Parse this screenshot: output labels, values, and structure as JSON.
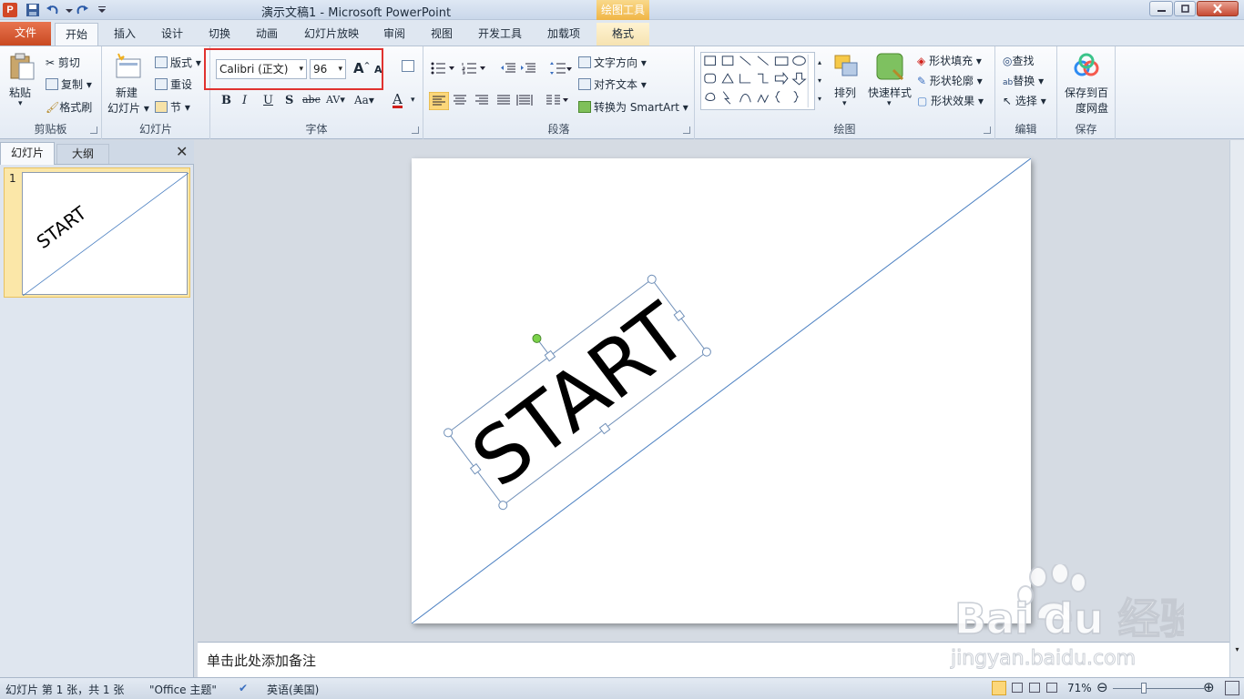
{
  "window": {
    "title": "演示文稿1 - Microsoft PowerPoint",
    "contextual_header": "绘图工具"
  },
  "app_icon_letter": "P",
  "tabs": [
    {
      "label": "文件"
    },
    {
      "label": "开始"
    },
    {
      "label": "插入"
    },
    {
      "label": "设计"
    },
    {
      "label": "切换"
    },
    {
      "label": "动画"
    },
    {
      "label": "幻灯片放映"
    },
    {
      "label": "审阅"
    },
    {
      "label": "视图"
    },
    {
      "label": "开发工具"
    },
    {
      "label": "加载项"
    },
    {
      "label": "格式"
    }
  ],
  "clipboard": {
    "label": "剪贴板",
    "paste": "粘贴",
    "cut": "剪切",
    "copy": "复制",
    "format_painter": "格式刷"
  },
  "slides_group": {
    "label": "幻灯片",
    "new_line1": "新建",
    "new_line2": "幻灯片",
    "layout": "版式",
    "reset": "重设",
    "section": "节"
  },
  "font_group": {
    "label": "字体",
    "font_name": "Calibri (正文)",
    "font_size": "96"
  },
  "paragraph": {
    "label": "段落",
    "text_direction": "文字方向",
    "align_text": "对齐文本",
    "smartart": "转换为 SmartArt"
  },
  "drawing": {
    "label": "绘图",
    "arrange": "排列",
    "quick_styles": "快速样式",
    "shape_fill": "形状填充",
    "shape_outline": "形状轮廓",
    "shape_effects": "形状效果"
  },
  "editing": {
    "label": "编辑",
    "find": "查找",
    "replace": "替换",
    "select": "选择"
  },
  "save_group": {
    "label": "保存",
    "save_line1": "保存到百",
    "save_line2": "度网盘"
  },
  "left_panel": {
    "tab_slides": "幻灯片",
    "tab_outline": "大纲",
    "close": "✕",
    "slide_number": "1"
  },
  "slide": {
    "text": "START"
  },
  "notes": {
    "placeholder": "单击此处添加备注"
  },
  "status": {
    "slide_info": "幻灯片 第 1 张，共 1 张",
    "theme": "\"Office 主题\"",
    "language": "英语(美国)",
    "zoom": "71%"
  },
  "watermark": {
    "brand": "Bai du 经验",
    "url": "jingyan.baidu.com"
  },
  "colors": {
    "file_tab": "#d24726",
    "accent_line": "#4a7fc1",
    "highlight_box": "#e0322f",
    "contextual": "#f0b545"
  }
}
